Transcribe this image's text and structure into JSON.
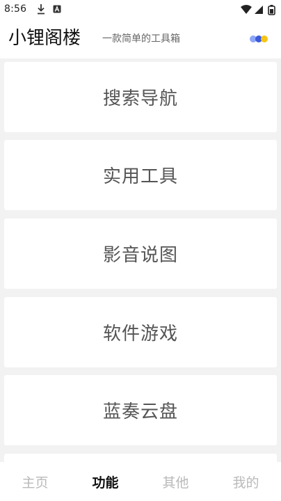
{
  "status_bar": {
    "time": "8:56",
    "icons": [
      "download-icon",
      "a-badge-icon",
      "wifi-icon",
      "signal-icon",
      "battery-icon"
    ]
  },
  "header": {
    "title": "小锂阁楼",
    "subtitle": "一款简单的工具箱",
    "menu_icon": "three-dots-icon",
    "dot_colors": [
      "#8ea6f8",
      "#3b5bdb",
      "#f5c518"
    ]
  },
  "cards": [
    {
      "label": "搜索导航"
    },
    {
      "label": "实用工具"
    },
    {
      "label": "影音说图"
    },
    {
      "label": "软件游戏"
    },
    {
      "label": "蓝奏云盘"
    }
  ],
  "bottom_nav": {
    "items": [
      {
        "label": "主页"
      },
      {
        "label": "功能"
      },
      {
        "label": "其他"
      },
      {
        "label": "我的"
      }
    ],
    "active": "功能"
  },
  "colors": {
    "background": "#f2f2f2",
    "card": "#ffffff",
    "card_text": "#555555",
    "nav_inactive": "#b9b9b9",
    "nav_active": "#111111"
  }
}
